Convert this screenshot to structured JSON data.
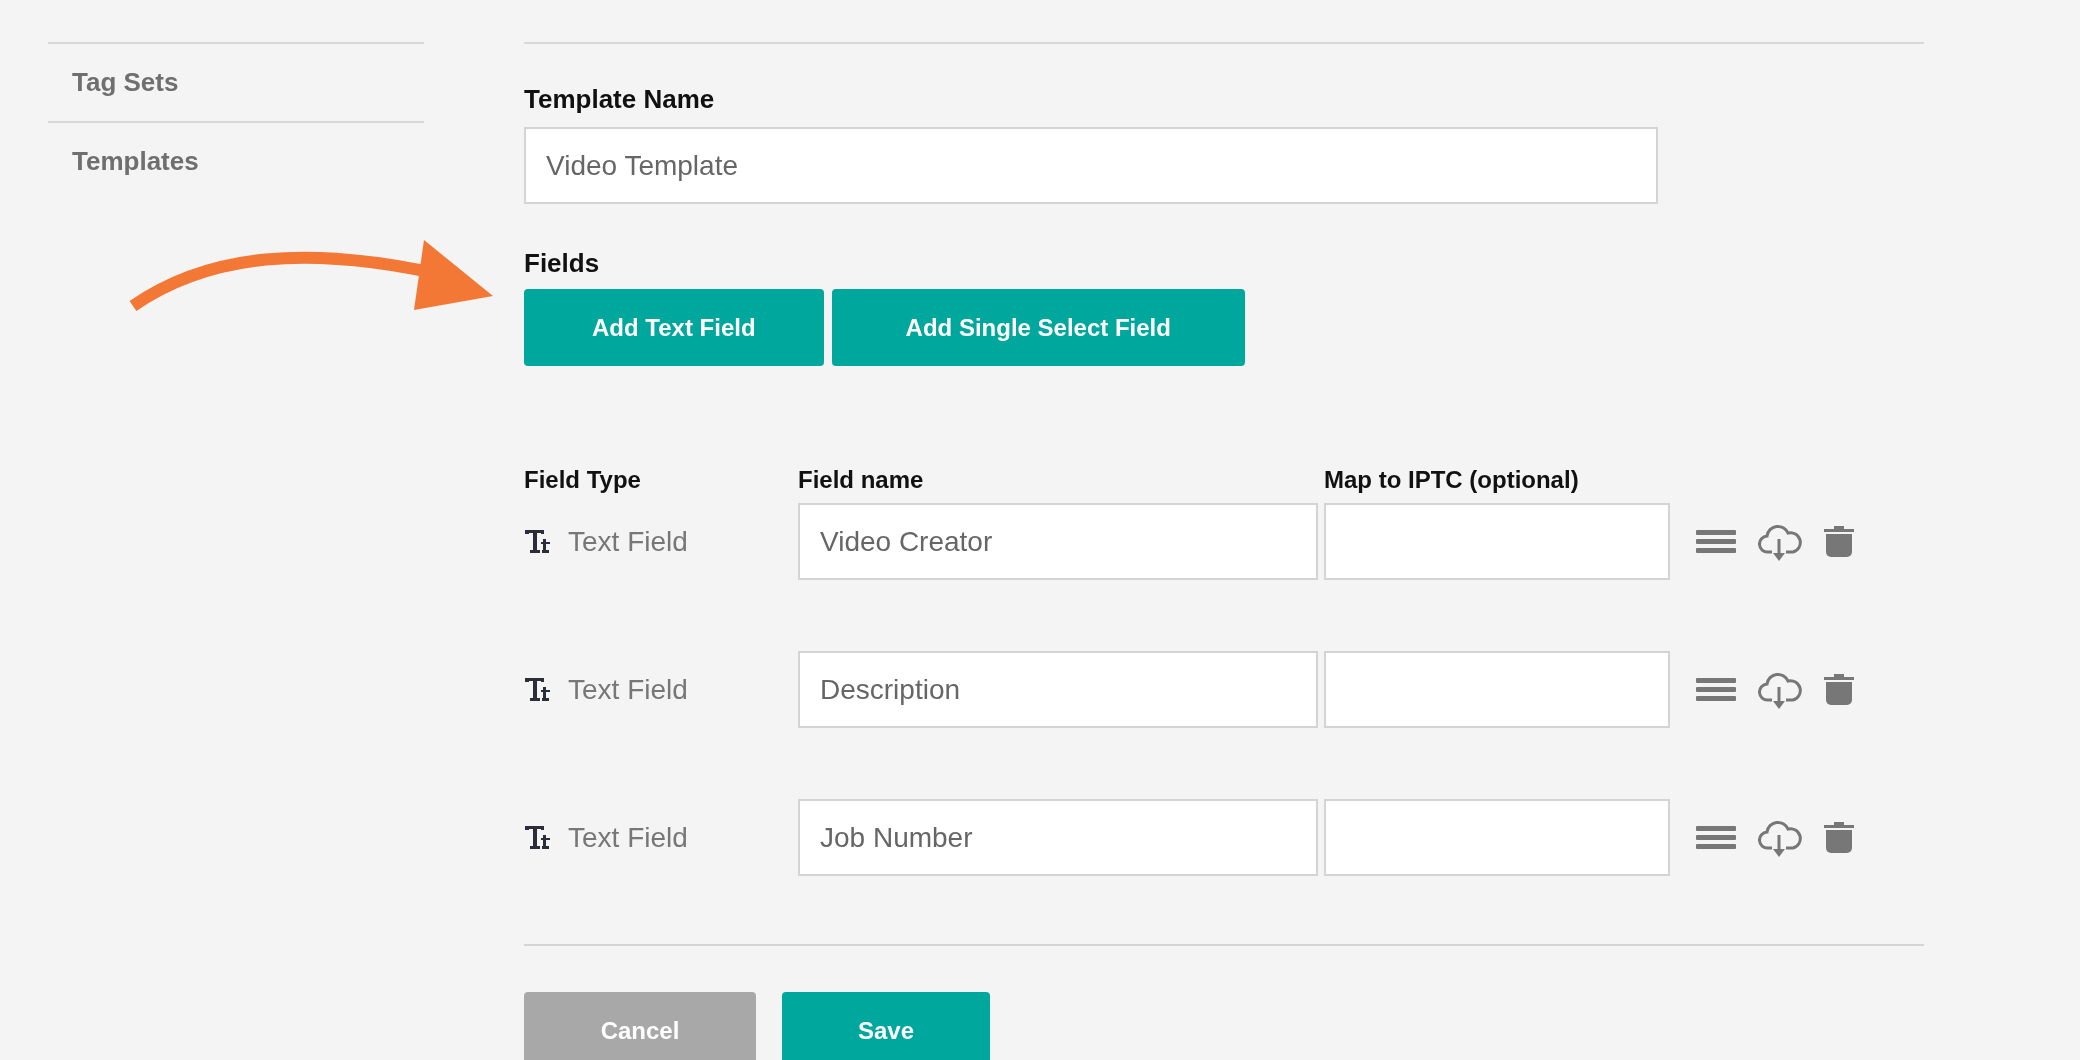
{
  "sidebar": {
    "items": [
      {
        "label": "Tag Sets"
      },
      {
        "label": "Templates"
      }
    ]
  },
  "template_name": {
    "label": "Template Name",
    "value": "Video Template"
  },
  "fields": {
    "label": "Fields",
    "buttons": [
      "Add Text Field",
      "Add Single Select Field"
    ]
  },
  "table": {
    "columns": [
      "Field Type",
      "Field name",
      "Map to IPTC (optional)"
    ],
    "rows": [
      {
        "type": "Text Field",
        "name": "Video Creator"
      },
      {
        "type": "Text Field",
        "name": "Description"
      },
      {
        "type": "Text Field",
        "name": "Job Number"
      }
    ]
  },
  "actions": [
    {
      "label": "Cancel",
      "kind": "secondary"
    },
    {
      "label": "Save",
      "kind": "primary"
    }
  ]
}
